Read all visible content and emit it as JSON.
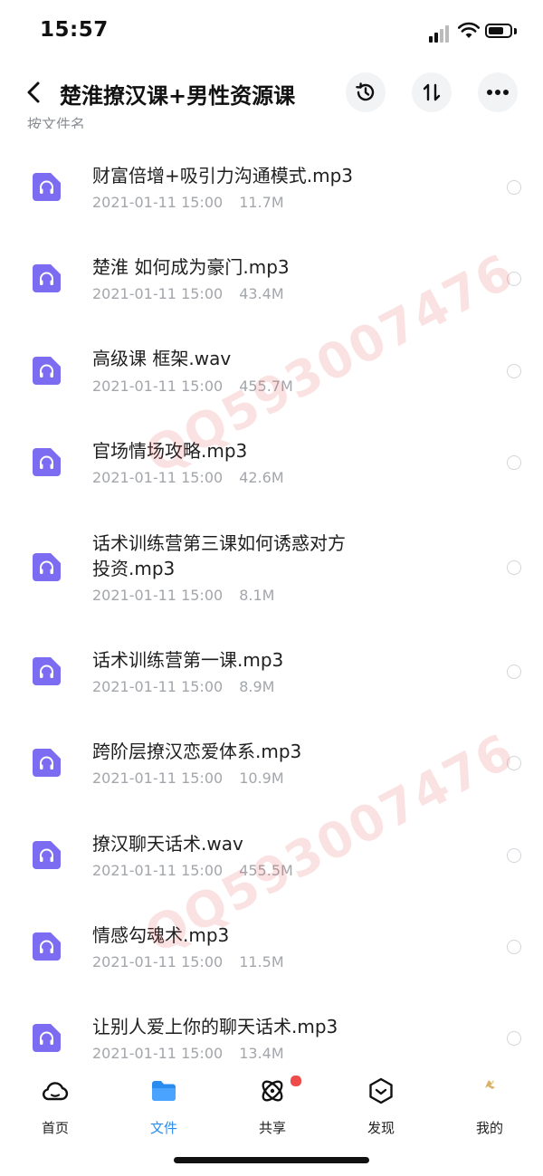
{
  "status_bar": {
    "time": "15:57"
  },
  "header": {
    "title": "楚淮撩汉课+男性资源课",
    "sort_label": "按文件名"
  },
  "files": [
    {
      "name": "财富倍增+吸引力沟通模式.mp3",
      "date": "2021-01-11 15:00",
      "size": "11.7M"
    },
    {
      "name": "楚淮 如何成为豪门.mp3",
      "date": "2021-01-11 15:00",
      "size": "43.4M"
    },
    {
      "name": "高级课 框架.wav",
      "date": "2021-01-11 15:00",
      "size": "455.7M"
    },
    {
      "name": "官场情场攻略.mp3",
      "date": "2021-01-11 15:00",
      "size": "42.6M"
    },
    {
      "name": "话术训练营第三课如何诱惑对方",
      "name2": "投资.mp3",
      "date": "2021-01-11 15:00",
      "size": "8.1M"
    },
    {
      "name": "话术训练营第一课.mp3",
      "date": "2021-01-11 15:00",
      "size": "8.9M"
    },
    {
      "name": "跨阶层撩汉恋爱体系.mp3",
      "date": "2021-01-11 15:00",
      "size": "10.9M"
    },
    {
      "name": "撩汉聊天话术.wav",
      "date": "2021-01-11 15:00",
      "size": "455.5M"
    },
    {
      "name": "情感勾魂术.mp3",
      "date": "2021-01-11 15:00",
      "size": "11.5M"
    },
    {
      "name": "让别人爱上你的聊天话术.mp3",
      "date": "2021-01-11 15:00",
      "size": "13.4M"
    }
  ],
  "watermark": "QQ593007476",
  "tabs": [
    {
      "label": "首页",
      "icon": "cloud-icon"
    },
    {
      "label": "文件",
      "icon": "folder-icon"
    },
    {
      "label": "共享",
      "icon": "share-atom-icon"
    },
    {
      "label": "发现",
      "icon": "discover-icon"
    },
    {
      "label": "我的",
      "icon": "profile-icon"
    }
  ],
  "colors": {
    "accent": "#2b8cf0",
    "file_icon": "#7b6cf2",
    "badge": "#ee4b4b"
  }
}
